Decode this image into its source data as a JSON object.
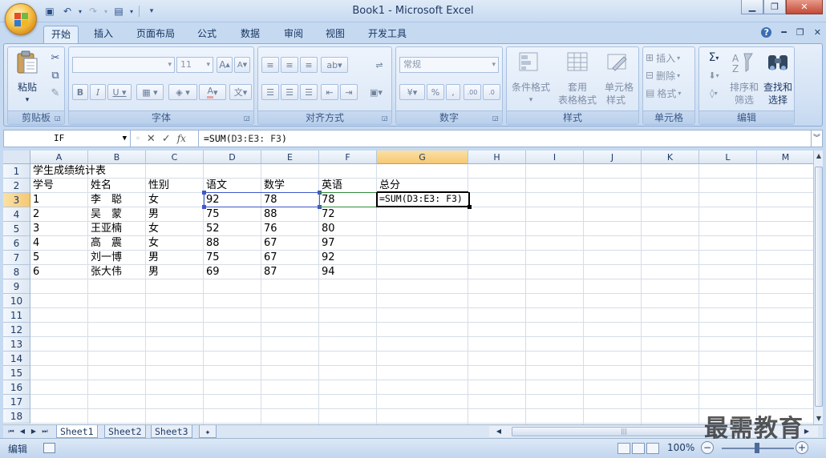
{
  "window": {
    "title": "Book1 - Microsoft Excel"
  },
  "ribbon_tabs": [
    "开始",
    "插入",
    "页面布局",
    "公式",
    "数据",
    "审阅",
    "视图",
    "开发工具"
  ],
  "groups": {
    "clipboard": {
      "label": "剪贴板",
      "paste": "粘贴"
    },
    "font": {
      "label": "字体",
      "size": "11"
    },
    "alignment": {
      "label": "对齐方式"
    },
    "number": {
      "label": "数字",
      "format": "常规"
    },
    "styles": {
      "label": "样式",
      "conditional": "条件格式",
      "table_1": "套用",
      "table_2": "表格格式",
      "cell_1": "单元格",
      "cell_2": "样式"
    },
    "cells": {
      "label": "单元格",
      "insert": "插入",
      "delete": "删除",
      "format": "格式"
    },
    "editing": {
      "label": "编辑",
      "sort_1": "排序和",
      "sort_2": "筛选",
      "find_1": "查找和",
      "find_2": "选择"
    }
  },
  "formula_bar": {
    "name_box": "IF",
    "fx": "fx",
    "formula_prefix": "=SUM(",
    "formula_ref": "D3:E3: F3",
    "formula_suffix": ")"
  },
  "columns": [
    "A",
    "B",
    "C",
    "D",
    "E",
    "F",
    "G",
    "H",
    "I",
    "J",
    "K",
    "L",
    "M"
  ],
  "rows": [
    "1",
    "2",
    "3",
    "4",
    "5",
    "6",
    "7",
    "8",
    "9",
    "10",
    "11",
    "12",
    "13",
    "14",
    "15",
    "16",
    "17",
    "18"
  ],
  "sheet": {
    "title": "学生成绩统计表",
    "headers": [
      "学号",
      "姓名",
      "性别",
      "语文",
      "数学",
      "英语",
      "总分"
    ],
    "data": [
      [
        "1",
        "李　聪",
        "女",
        "92",
        "78",
        "78"
      ],
      [
        "2",
        "吴　蒙",
        "男",
        "75",
        "88",
        "72"
      ],
      [
        "3",
        "王亚楠",
        "女",
        "52",
        "76",
        "80"
      ],
      [
        "4",
        "高　震",
        "女",
        "88",
        "67",
        "97"
      ],
      [
        "5",
        "刘一博",
        "男",
        "75",
        "67",
        "92"
      ],
      [
        "6",
        "张大伟",
        "男",
        "69",
        "87",
        "94"
      ]
    ],
    "editing_cell": "=SUM(D3:E3: F3)"
  },
  "sheet_tabs": [
    "Sheet1",
    "Sheet2",
    "Sheet3"
  ],
  "status": {
    "mode": "编辑",
    "zoom": "100%"
  },
  "watermark": "最需教育"
}
